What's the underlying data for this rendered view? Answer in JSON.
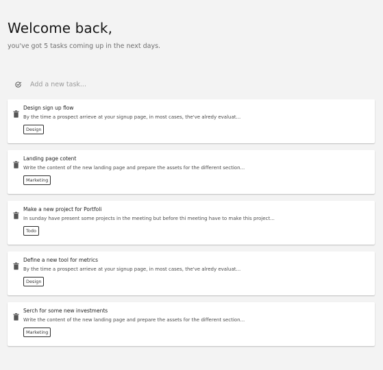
{
  "header": {
    "greeting": "Welcome back,",
    "subtitle": "you've got 5 tasks coming up in the next days."
  },
  "add_task": {
    "icon": "check-circle-icon",
    "placeholder": "Add a new task..."
  },
  "tasks": [
    {
      "title": "Design sign up flow",
      "description": "By the time a prospect arrieve at your signup page, in most cases, the've alredy evaluat...",
      "tag": "Design"
    },
    {
      "title": "Landing page cotent",
      "description": "Write the content of the new landing page and prepare the assets for the different section...",
      "tag": "Marketing"
    },
    {
      "title": "Make a new project for Portfoli",
      "description": "In sunday have present some projects in the meeting but before thi meeting have to make this project...",
      "tag": "Todo"
    },
    {
      "title": "Define a new tool for metrics",
      "description": "By the time a prospect arrieve at your signup page, in most cases, the've alredy evaluat...",
      "tag": "Design"
    },
    {
      "title": "Serch for some new investments",
      "description": "Write the content of the new landing page and prepare the assets for the different section...",
      "tag": "Marketing"
    }
  ],
  "colors": {
    "background": "#f3f3f3",
    "card": "#ffffff",
    "text": "#1b1b1b",
    "muted": "#6f6f6f"
  }
}
